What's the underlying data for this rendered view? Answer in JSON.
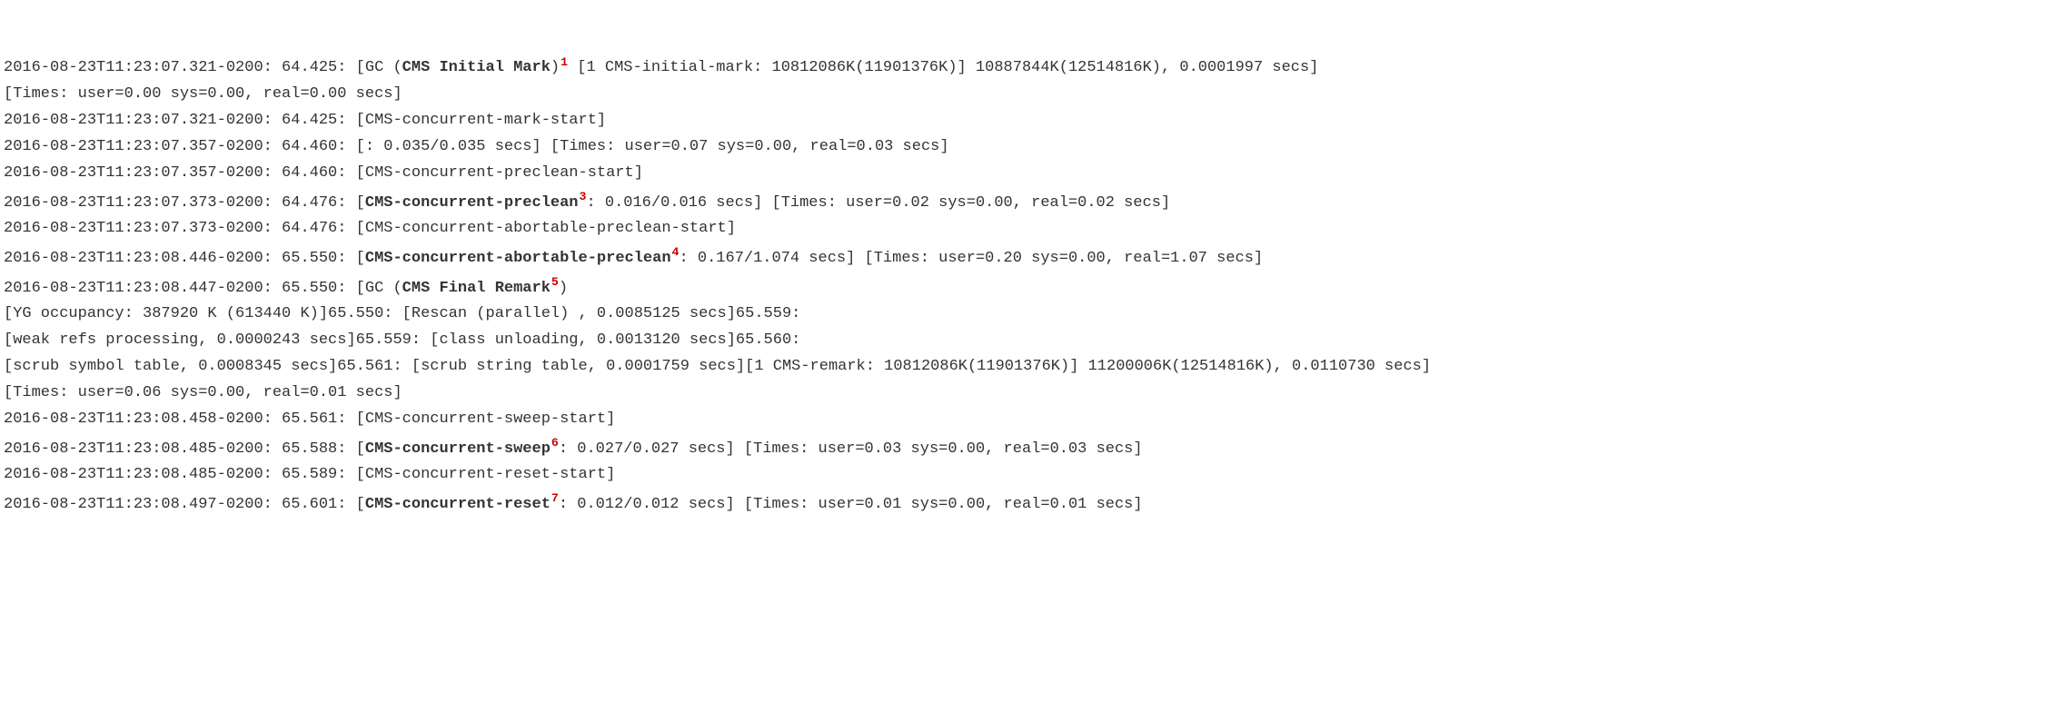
{
  "lines": [
    {
      "segs": [
        "2016-08-23T11:23:07.321-0200: 64.425: [GC (",
        "CMS Initial Mark",
        ")",
        "1",
        " [1 CMS-initial-mark: 10812086K(11901376K)] 10887844K(12514816K), 0.0001997 secs]"
      ]
    },
    {
      "segs": [
        "[Times: user=0.00 sys=0.00, real=0.00 secs]"
      ]
    },
    {
      "segs": [
        "2016-08-23T11:23:07.321-0200: 64.425: [CMS-concurrent-mark-start]"
      ]
    },
    {
      "segs": [
        "2016-08-23T11:23:07.357-0200: 64.460: [: 0.035/0.035 secs] [Times: user=0.07 sys=0.00, real=0.03 secs]"
      ]
    },
    {
      "segs": [
        "2016-08-23T11:23:07.357-0200: 64.460: [CMS-concurrent-preclean-start]"
      ]
    },
    {
      "segs": [
        "2016-08-23T11:23:07.373-0200: 64.476: [",
        "CMS-concurrent-preclean",
        "3",
        ": 0.016/0.016 secs] [Times: user=0.02 sys=0.00, real=0.02 secs]"
      ]
    },
    {
      "segs": [
        "2016-08-23T11:23:07.373-0200: 64.476: [CMS-concurrent-abortable-preclean-start]"
      ]
    },
    {
      "segs": [
        "2016-08-23T11:23:08.446-0200: 65.550: [",
        "CMS-concurrent-abortable-preclean",
        "4",
        ": 0.167/1.074 secs] [Times: user=0.20 sys=0.00, real=1.07 secs]"
      ]
    },
    {
      "segs": [
        "2016-08-23T11:23:08.447-0200: 65.550: [GC (",
        "CMS Final Remark",
        "5",
        ")"
      ]
    },
    {
      "segs": [
        "[YG occupancy: 387920 K (613440 K)]65.550: [Rescan (parallel) , 0.0085125 secs]65.559:"
      ]
    },
    {
      "segs": [
        "[weak refs processing, 0.0000243 secs]65.559: [class unloading, 0.0013120 secs]65.560:"
      ]
    },
    {
      "segs": [
        "[scrub symbol table, 0.0008345 secs]65.561: [scrub string table, 0.0001759 secs][1 CMS-remark: 10812086K(11901376K)] 11200006K(12514816K), 0.0110730 secs]"
      ]
    },
    {
      "segs": [
        "[Times: user=0.06 sys=0.00, real=0.01 secs]"
      ]
    },
    {
      "segs": [
        "2016-08-23T11:23:08.458-0200: 65.561: [CMS-concurrent-sweep-start]"
      ]
    },
    {
      "segs": [
        "2016-08-23T11:23:08.485-0200: 65.588: [",
        "CMS-concurrent-sweep",
        "6",
        ": 0.027/0.027 secs] [Times: user=0.03 sys=0.00, real=0.03 secs]"
      ]
    },
    {
      "segs": [
        "2016-08-23T11:23:08.485-0200: 65.589: [CMS-concurrent-reset-start]"
      ]
    },
    {
      "segs": [
        "2016-08-23T11:23:08.497-0200: 65.601: [",
        "CMS-concurrent-reset",
        "7",
        ": 0.012/0.012 secs] [Times: user=0.01 sys=0.00, real=0.01 secs]"
      ]
    }
  ]
}
